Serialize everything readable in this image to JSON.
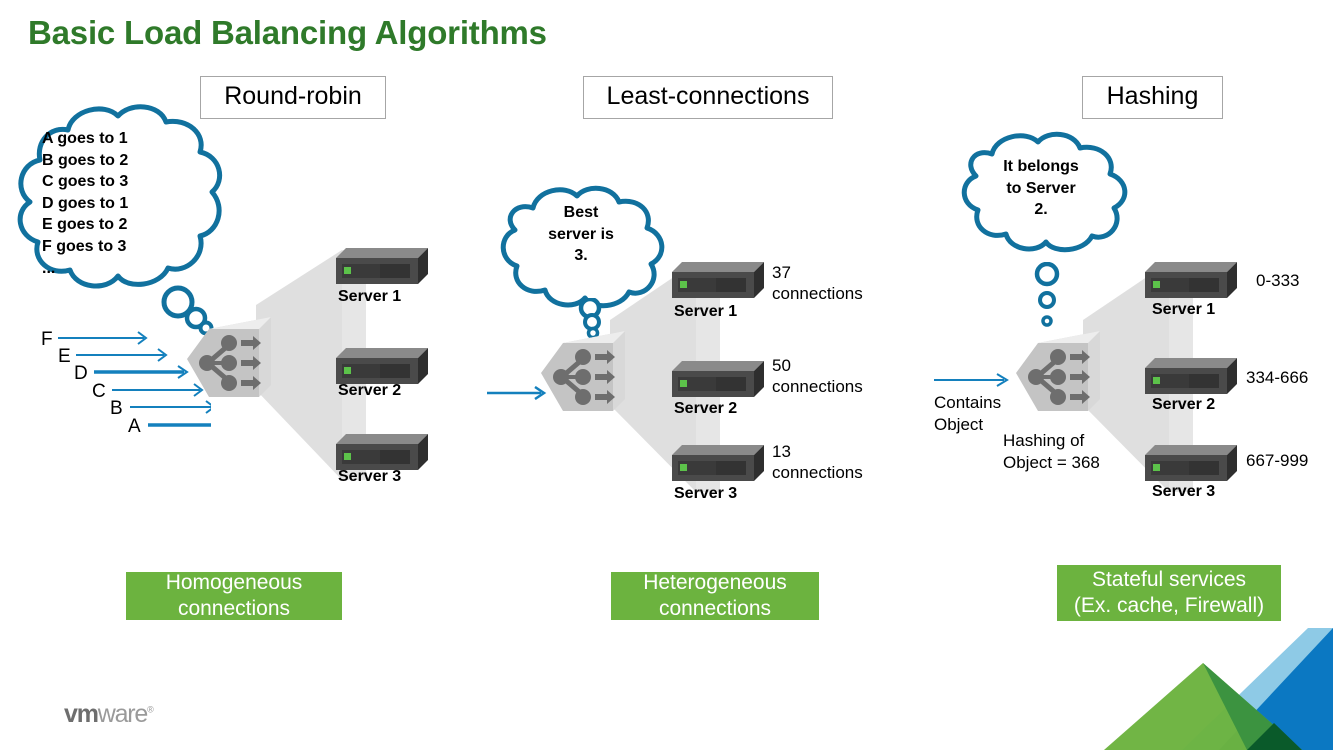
{
  "slide": {
    "title": "Basic Load Balancing Algorithms",
    "background_color": "#ffffff",
    "title_color": "#2f7a2a"
  },
  "columns": [
    {
      "id": "round-robin",
      "header": "Round-robin",
      "cloud_text": "A goes to 1\nB goes to 2\nC goes to 3\nD goes to 1\nE goes to 2\nF goes to 3\n...",
      "flow_letters": [
        "F",
        "E",
        "D",
        "C",
        "B",
        "A"
      ],
      "servers": [
        {
          "label": "Server 1",
          "note": ""
        },
        {
          "label": "Server 2",
          "note": ""
        },
        {
          "label": "Server 3",
          "note": ""
        }
      ],
      "caption": "Homogeneous\nconnections"
    },
    {
      "id": "least-connections",
      "header": "Least-connections",
      "cloud_text": "Best\nserver is\n3.",
      "servers": [
        {
          "label": "Server 1",
          "note": "37\nconnections"
        },
        {
          "label": "Server 2",
          "note": "50\nconnections"
        },
        {
          "label": "Server 3",
          "note": "13\nconnections"
        }
      ],
      "caption": "Heterogeneous\nconnections"
    },
    {
      "id": "hashing",
      "header": "Hashing",
      "cloud_text": "It belongs\nto Server\n2.",
      "inbound_label": "Contains\nObject",
      "hash_label": "Hashing of\nObject = 368",
      "servers": [
        {
          "label": "Server 1",
          "note": "0-333"
        },
        {
          "label": "Server 2",
          "note": "334-666"
        },
        {
          "label": "Server 3",
          "note": "667-999"
        }
      ],
      "caption": "Stateful services\n(Ex. cache, Firewall)"
    }
  ],
  "logo": {
    "vm": "vm",
    "ware": "ware",
    "registered": "®"
  },
  "colors": {
    "title_green": "#2f7a2a",
    "caption_green": "#6cb33f",
    "cloud_blue": "#11719e",
    "arrow_blue": "#1480bd",
    "server_front": "#4a4a4a",
    "server_led": "#5cc24a",
    "fan_gray": "#dcdcdc",
    "corner_green": "#6cb33f",
    "corner_light_blue": "#8ecae6",
    "corner_blue": "#0b78c2",
    "corner_dark_green": "#0a5a2a"
  },
  "icons": {
    "server": "server-icon",
    "load_balancer": "load-balancer-icon",
    "thought_cloud": "thought-cloud-icon",
    "flow_arrow": "arrow-right-icon"
  }
}
